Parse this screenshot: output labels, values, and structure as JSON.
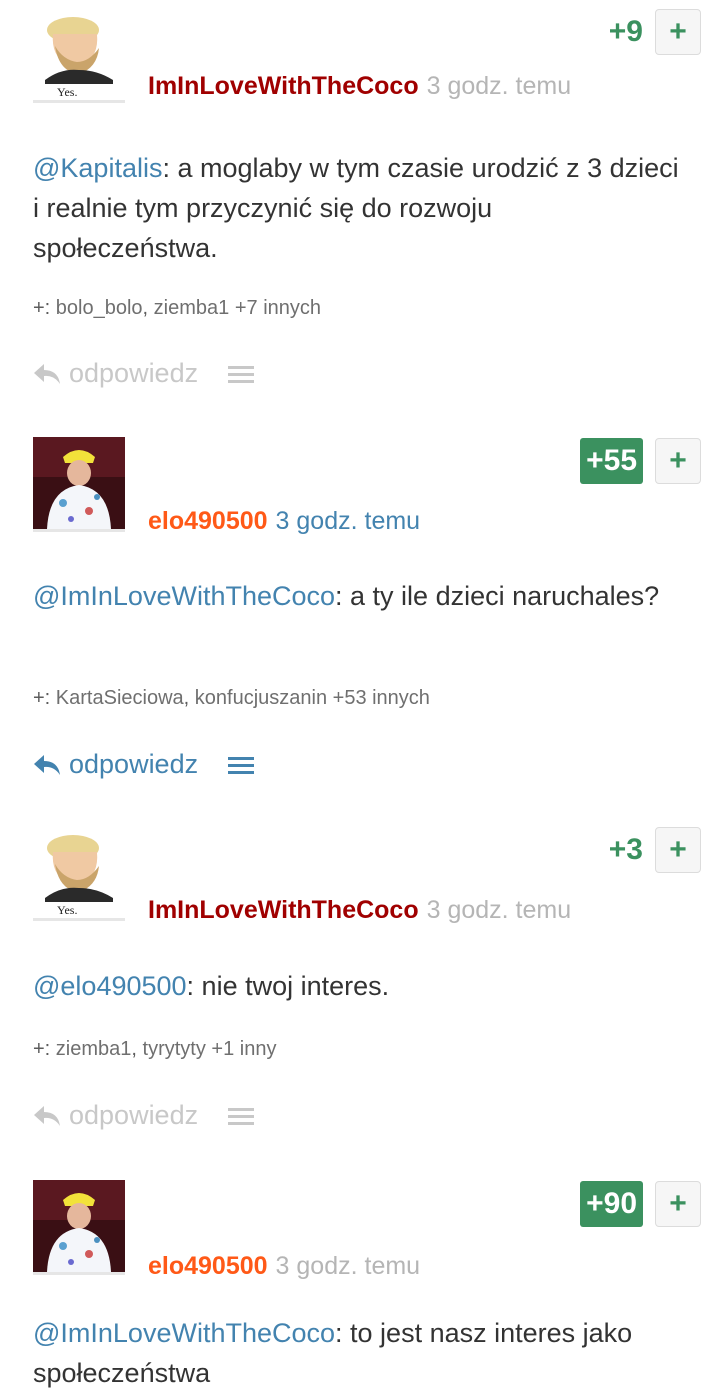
{
  "comments": [
    {
      "author": "ImInLoveWithTheCoco",
      "time": "3 godz. temu",
      "score": "+9",
      "vote_plus": "+",
      "mention": "@Kapitalis",
      "text": ": a moglaby w tym czasie urodzić z 3 dzieci i realnie tym przyczynić się do rozwoju społeczeństwa.",
      "voters_prefix": "+: ",
      "voter_1": "bolo_bolo",
      "voter_sep": ", ",
      "voter_2": "ziemba1",
      "voters_more": " +7 innych",
      "reply_label": "odpowiedz",
      "avatar_caption": "Yes.",
      "avatar": "yes-chad-meme-avatar"
    },
    {
      "author": "elo490500",
      "time": "3 godz. temu",
      "score": "+55",
      "vote_plus": "+",
      "mention": "@ImInLoveWithTheCoco",
      "text": ": a ty ile dzieci naruchales?",
      "voters_prefix": "+: ",
      "voter_1": "KartaSieciowa",
      "voter_sep": ", ",
      "voter_2": "konfucjuszanin",
      "voters_more": " +53 innych",
      "reply_label": "odpowiedz",
      "avatar": "user-photo-avatar"
    },
    {
      "author": "ImInLoveWithTheCoco",
      "time": "3 godz. temu",
      "score": "+3",
      "vote_plus": "+",
      "mention": "@elo490500",
      "text": ": nie twoj interes.",
      "voters_prefix": "+: ",
      "voter_1": "ziemba1",
      "voter_sep": ", ",
      "voter_2": "tyrytyty",
      "voters_more": " +1 inny",
      "reply_label": "odpowiedz",
      "avatar_caption": "Yes.",
      "avatar": "yes-chad-meme-avatar"
    },
    {
      "author": "elo490500",
      "time": "3 godz. temu",
      "score": "+90",
      "vote_plus": "+",
      "mention": "@ImInLoveWithTheCoco",
      "text": ": to jest nasz interes jako społeczeństwa",
      "avatar": "user-photo-avatar"
    }
  ],
  "colors": {
    "author_red": "#a00000",
    "author_orange": "#ff5917",
    "vote_green": "#3b915f",
    "link_blue": "#4383af",
    "muted_grey": "#b5b5b5"
  }
}
